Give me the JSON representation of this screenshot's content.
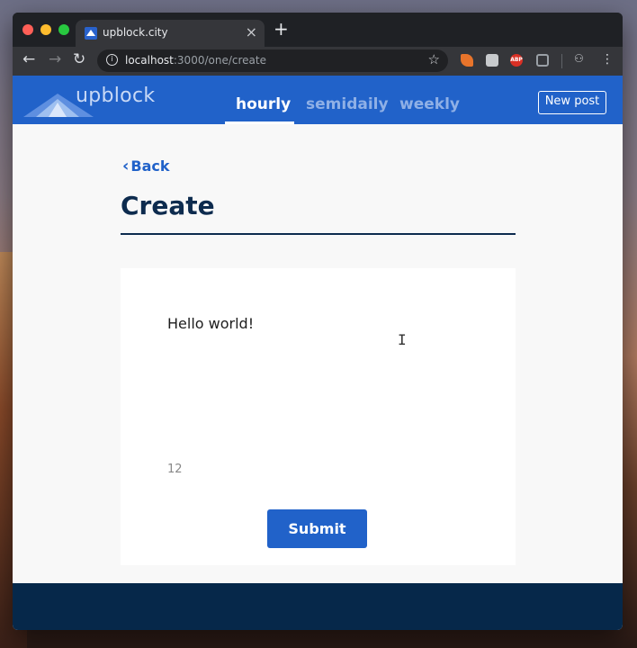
{
  "browser": {
    "tab_title": "upblock.city",
    "url_host": "localhost",
    "url_path": ":3000/one/create",
    "icons": {
      "back": "back-arrow-icon",
      "forward": "forward-arrow-icon",
      "reload": "reload-icon",
      "bookmark": "star-icon",
      "menu": "kebab-menu-icon",
      "ext_abp_label": "ABP"
    }
  },
  "header": {
    "brand": "upblock",
    "nav": [
      {
        "label": "hourly",
        "active": true
      },
      {
        "label": "semidaily",
        "active": false
      },
      {
        "label": "weekly",
        "active": false
      }
    ],
    "new_post_label": "New post"
  },
  "main": {
    "back_label": "Back",
    "title": "Create",
    "editor_text": "Hello world!",
    "char_count": "12",
    "submit_label": "Submit"
  },
  "colors": {
    "brand_blue": "#2162c9",
    "title_navy": "#0d2b4e",
    "footer_navy": "#06284a"
  }
}
